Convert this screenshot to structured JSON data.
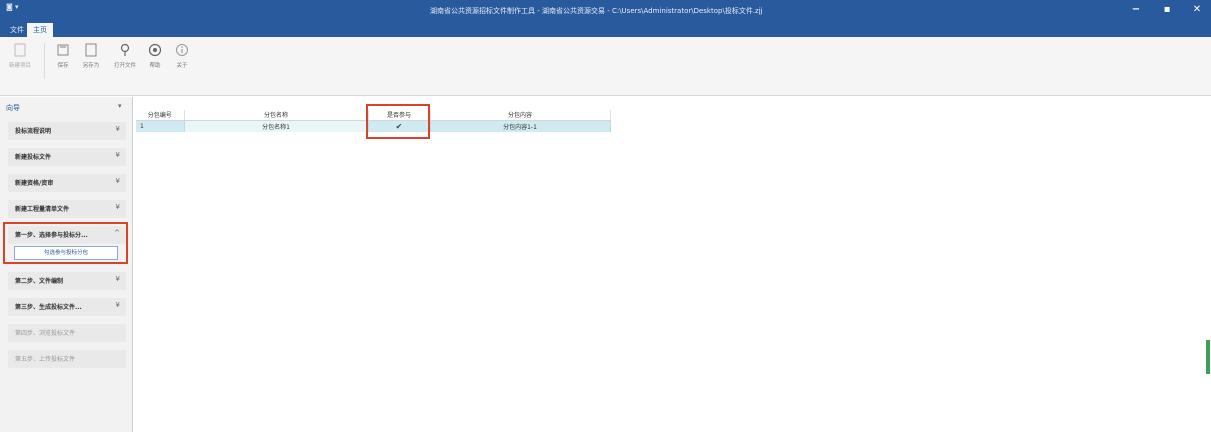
{
  "window": {
    "quick_access": "◙ ▾",
    "title": "湖南省公共资源招标文件制作工具 - 湖南省公共资源交易 - C:\\Users\\Administrator\\Desktop\\投标文件.zjj",
    "minimize": "−",
    "maximize": "▪",
    "close": "✕"
  },
  "menu_tabs": [
    {
      "label": "文件"
    },
    {
      "label": "主页"
    }
  ],
  "ribbon": {
    "buttons": [
      {
        "label": "新建项目",
        "icon": "new-project-icon"
      },
      {
        "label": "保存",
        "icon": "save-icon"
      },
      {
        "label": "另存为",
        "icon": "save-as-icon"
      },
      {
        "label": "打开文件",
        "icon": "location-icon"
      },
      {
        "label": "帮助",
        "icon": "help-icon"
      },
      {
        "label": "关于",
        "icon": "info-icon"
      }
    ]
  },
  "sidebar": {
    "title": "向导",
    "pin": "▾",
    "items": [
      {
        "label": "投标流程说明",
        "chevron": "¥"
      },
      {
        "label": "新建投标文件",
        "chevron": "¥"
      },
      {
        "label": "新建资格/资审",
        "chevron": "¥"
      },
      {
        "label": "新建工程量清单文件",
        "chevron": "¥"
      },
      {
        "label": "第一步、选择参与投标分...",
        "chevron": "^"
      },
      {
        "label": "第二步、文件编制",
        "chevron": "¥"
      },
      {
        "label": "第三步、生成投标文件...",
        "chevron": "¥"
      },
      {
        "label": "第四步、浏览投标文件",
        "chevron": ""
      },
      {
        "label": "第五步、上传投标文件",
        "chevron": ""
      }
    ],
    "sub_button": "勾选参与投标分包"
  },
  "grid": {
    "headers": [
      "分包编号",
      "分包名称",
      "是否参与",
      "分包内容"
    ],
    "rows": [
      {
        "id": "1",
        "name": "分包名称1",
        "participate": "✔",
        "content": "分包内容1-1"
      }
    ]
  }
}
